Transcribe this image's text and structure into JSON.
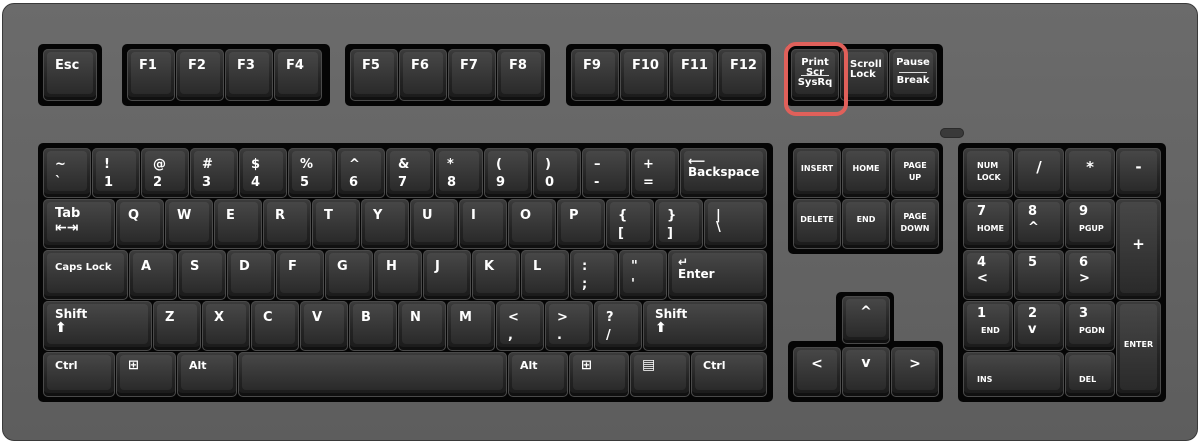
{
  "keys": {
    "esc": "Esc",
    "f1": "F1",
    "f2": "F2",
    "f3": "F3",
    "f4": "F4",
    "f5": "F5",
    "f6": "F6",
    "f7": "F7",
    "f8": "F8",
    "f9": "F9",
    "f10": "F10",
    "f11": "F11",
    "f12": "F12",
    "prtsc_top": "Print\nScr",
    "prtsc_bottom": "SysRq",
    "scroll": "Scroll\nLock",
    "pause_top": "Pause",
    "pause_bottom": "Break",
    "tilde_top": "~",
    "tilde_bottom": "`",
    "n1_top": "!",
    "n1_bottom": "1",
    "n2_top": "@",
    "n2_bottom": "2",
    "n3_top": "#",
    "n3_bottom": "3",
    "n4_top": "$",
    "n4_bottom": "4",
    "n5_top": "%",
    "n5_bottom": "5",
    "n6_top": "^",
    "n6_bottom": "6",
    "n7_top": "&",
    "n7_bottom": "7",
    "n8_top": "*",
    "n8_bottom": "8",
    "n9_top": "(",
    "n9_bottom": "9",
    "n0_top": ")",
    "n0_bottom": "0",
    "minus_top": "–",
    "minus_bottom": "-",
    "plus_top": "+",
    "plus_bottom": "=",
    "backspace": "Backspace",
    "tab": "Tab",
    "q": "Q",
    "w": "W",
    "e": "E",
    "r": "R",
    "t": "T",
    "y": "Y",
    "u": "U",
    "i": "I",
    "o": "O",
    "p": "P",
    "lbrace_top": "{",
    "lbrace_bottom": "[",
    "rbrace_top": "}",
    "rbrace_bottom": "]",
    "pipe_top": "|",
    "pipe_bottom": "\\",
    "caps": "Caps Lock",
    "a": "A",
    "s": "S",
    "d": "D",
    "f": "F",
    "g": "G",
    "h": "H",
    "j": "J",
    "k": "K",
    "l": "L",
    "semi_top": ":",
    "semi_bottom": ";",
    "quote_top": "\"",
    "quote_bottom": "'",
    "enter": "Enter",
    "shift": "Shift",
    "z": "Z",
    "x": "X",
    "c": "C",
    "v": "V",
    "b": "B",
    "n": "N",
    "m": "M",
    "comma_top": "<",
    "comma_bottom": ",",
    "period_top": ">",
    "period_bottom": ".",
    "slash_top": "?",
    "slash_bottom": "/",
    "ctrl": "Ctrl",
    "alt": "Alt",
    "insert": "INSERT",
    "home": "HOME",
    "pgup": "PAGE\nUP",
    "delete": "DELETE",
    "end": "END",
    "pgdn": "PAGE\nDOWN",
    "numlock": "NUM\nLOCK",
    "ndiv": "/",
    "nmul": "*",
    "nminus": "-",
    "n7": "7",
    "n7s": "HOME",
    "n8": "8",
    "n8s": "^",
    "n9": "9",
    "n9s": "PGUP",
    "nplus": "+",
    "nn4": "4",
    "nn4s": "<",
    "nn5": "5",
    "nn6": "6",
    "nn6s": ">",
    "nn1": "1",
    "nn1s": "END",
    "nn2": "2",
    "nn2s": "v",
    "nn3": "3",
    "nn3s": "PGDN",
    "nenter": "ENTER",
    "nins": "INS",
    "ndel": "DEL",
    "up": "^",
    "left": "<",
    "down": "v",
    "right": ">"
  }
}
